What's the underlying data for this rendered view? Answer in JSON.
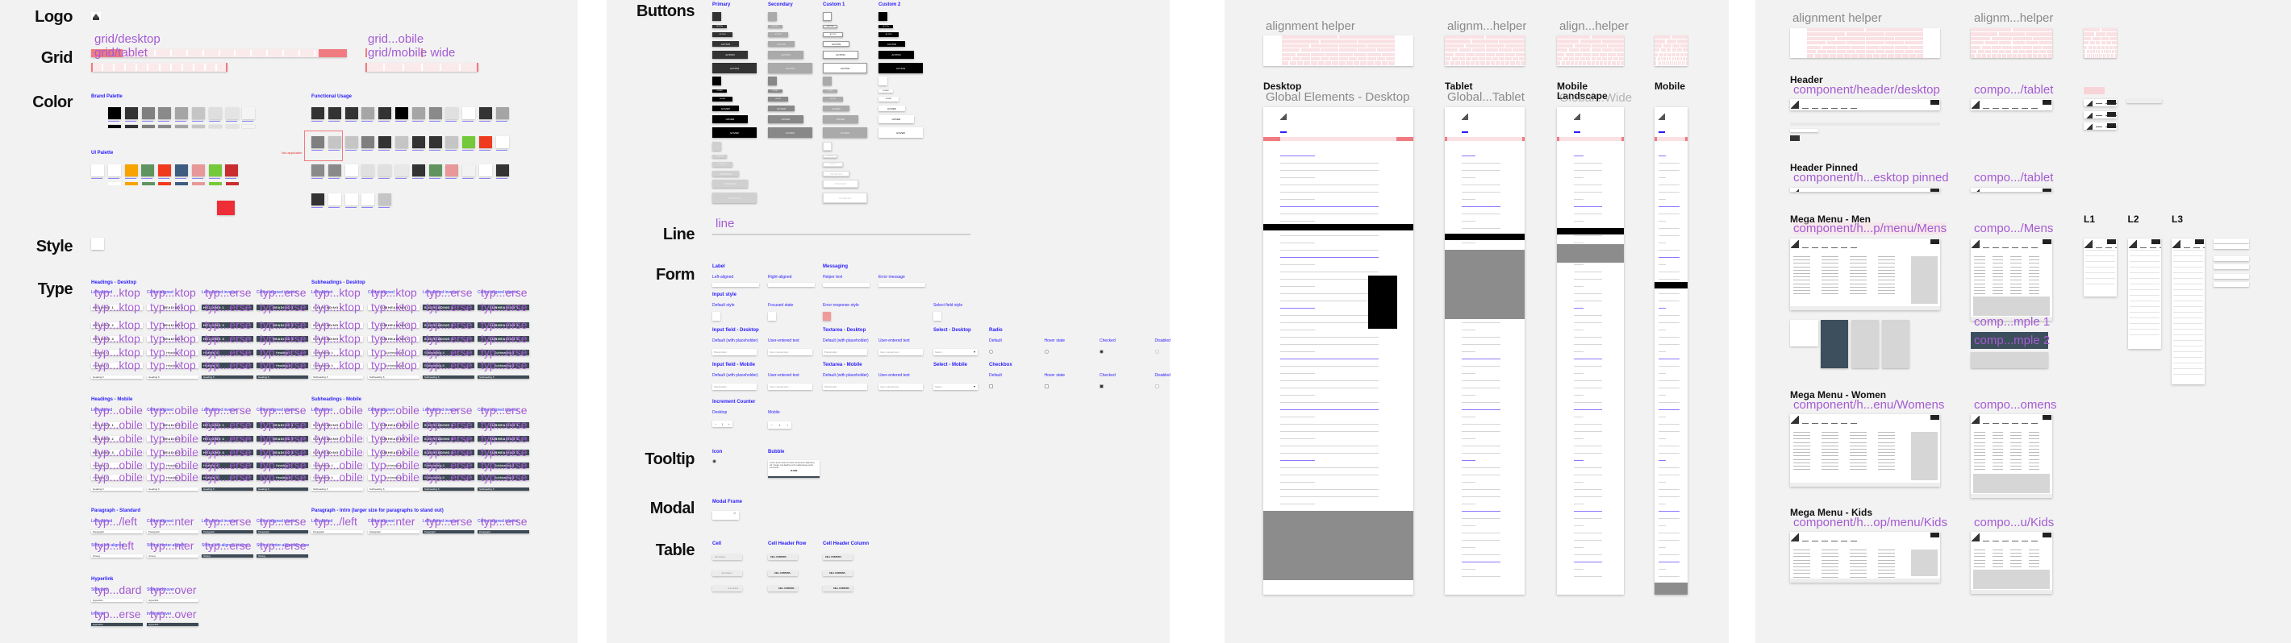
{
  "colors": {
    "panel": "#f2f2f2",
    "label_blue": "#2a1cff",
    "component_purple": "#a45bd3",
    "grid_red": "#f07b80",
    "inverse": "#3d4a55"
  },
  "foundations": {
    "logo": {
      "label": "Logo",
      "icon": "mountain-logo-icon"
    },
    "grid": {
      "label": "Grid",
      "desktop": "grid/desktop",
      "tablet": "grid/tablet",
      "mobile": "grid...obile",
      "mobile_wide": "grid/mobile wide"
    },
    "color": {
      "label": "Color",
      "brand_title": "Brand Palette",
      "ui_title": "UI Palette",
      "functional_title": "Functional Usage",
      "not_applicable": "Not applicable",
      "brand": [
        "#000000",
        "#333333",
        "#7f7f7f",
        "#8a8a8a",
        "#a5a5a5",
        "#c5c5c5",
        "#dedede",
        "#e4e4e4",
        "#f4f4f4"
      ],
      "ui": [
        "#ffffff",
        "#ffffff",
        "#f7a400",
        "#5f9460",
        "#f03a1e",
        "#3d5c80",
        "#e89898",
        "#74c93a",
        "#c92d2d"
      ],
      "ui_extra": "#ee2e36",
      "functional": [
        [
          "#333333",
          "#333333",
          "#333333",
          "#a5a5a5",
          "#333333",
          "#000000",
          "#a5a5a5",
          "#8a8a8a",
          "#e0e0e0",
          "#ffffff",
          "#333333",
          "#a5a5a5"
        ],
        [
          "#7f7f7f",
          "#c5c5c5",
          "#c5c5c5",
          "#7f7f7f",
          "#333333",
          "#c5c5c5",
          "#333333",
          "#333333",
          "#c5c5c5",
          "#74c93a",
          "#f03a1e",
          "#ffffff"
        ],
        [
          "#8a8a8a",
          "#8a8a8a",
          "#ffffff",
          "#e0e0e0",
          "#e0e0e0",
          "#e8e8e8",
          "#333333",
          "#5f9460",
          "#e89898",
          "#f2f2f2",
          "#ffffff",
          "#333333"
        ],
        [
          "#333333",
          "#ffffff",
          "#ffffff",
          "#ffffff",
          "#c5c5c5"
        ]
      ]
    },
    "style": {
      "label": "Style"
    },
    "type": {
      "label": "Type",
      "column_labels": [
        "Left-aligned",
        "Center-aligned",
        "Left-aligned inverse",
        "Center-aligned inverse"
      ],
      "groups": [
        {
          "title": "Headings - Desktop",
          "overlay": [
            "typ...ktop",
            "typ...ktop",
            "typ...erse",
            "typ...erse"
          ],
          "samples": [
            "HEADING 1",
            "HEADING 2",
            "HEADING 3",
            "Heading 4",
            "Heading 5"
          ],
          "small": "Heading 6"
        },
        {
          "title": "Subheadings - Desktop",
          "overlay": [
            "typ...ktop",
            "typ...ktop",
            "typ...erse",
            "typ...erse"
          ],
          "samples": [
            "SUBHEADING 1",
            "SUBHEADING 2",
            "SUBHEADING 3",
            "Subheading 4",
            "Subheading 5"
          ],
          "small": "Subheading 6"
        },
        {
          "title": "Headings - Mobile",
          "overlay": [
            "typ...obile",
            "typ...obile",
            "typ...erse",
            "typ...erse"
          ],
          "samples": [
            "HEADING 1",
            "HEADING 2",
            "HEADING 3",
            "Heading 4",
            "Heading 5"
          ],
          "small": "Heading 6"
        },
        {
          "title": "Subheadings - Mobile",
          "overlay": [
            "typ...obile",
            "typ...obile",
            "typ...erse",
            "typ...erse"
          ],
          "samples": [
            "SUBHEADING 1",
            "SUBHEADING 2",
            "SUBHEADING 3",
            "Subheading 4",
            "Subheading 5"
          ],
          "small": "Subheading 6"
        }
      ],
      "paragraph_standard": {
        "title": "Paragraph - Standard",
        "overlay": [
          "typ.../left",
          "typ...nter",
          "typ...erse",
          "typ...erse"
        ],
        "overlay2": [
          "typ...left",
          "typ...nter",
          "typ...erse",
          "typ...erse"
        ],
        "labels2": [
          "Strong left-aligned",
          "Strong center-aligned",
          "Strong left-aligned inverse",
          "Strong center-aligned inverse"
        ],
        "sample": "Paragraph",
        "sample2": "Strong"
      },
      "paragraph_intro": {
        "title": "Paragraph - Intro (larger size for paragraphs to stand out)",
        "overlay": [
          "typ.../left",
          "typ...nter",
          "typ...erse",
          "typ...erse"
        ],
        "sample": "Paragraph"
      },
      "hyperlink": {
        "title": "Hyperlink",
        "labels": [
          "Standard",
          "Standard hover"
        ],
        "overlay": [
          "typ...dard",
          "typ...over"
        ],
        "labels2": [
          "Inverse",
          "Inverse hover"
        ],
        "overlay2": [
          "typ...erse",
          "typ...over"
        ],
        "sample": "Hyperlink"
      }
    }
  },
  "components": {
    "buttons": {
      "label": "Buttons",
      "columns": [
        "Primary",
        "Secondary",
        "Custom 1",
        "Custom 2"
      ],
      "states": [
        "ACTION",
        "HOVER",
        "DISABLED"
      ]
    },
    "line": {
      "label": "Line",
      "component": "line"
    },
    "form": {
      "label": "Form",
      "label_title": "Label",
      "left_aligned": "Left-aligned",
      "right_aligned": "Right-aligned",
      "messaging_title": "Messaging",
      "helper_text": "Helper text",
      "error_message": "Error message",
      "input_style_title": "Input style",
      "default_style": "Default style",
      "focused_state": "Focused state",
      "error_style": "Error response style",
      "select_style": "Select field style",
      "input_desktop": "Input field - Desktop",
      "textarea_desktop": "Textarea - Desktop",
      "select_desktop": "Select - Desktop",
      "radio": "Radio",
      "input_mobile": "Input field - Mobile",
      "textarea_mobile": "Textarea - Mobile",
      "select_mobile": "Select - Mobile",
      "checkbox": "Checkbox",
      "default_placeholder": "Default (with placeholder)",
      "user_entered": "User-entered text",
      "placeholder": "Placeholder",
      "user_text": "User entered text...",
      "select_placeholder": "Select...",
      "states": [
        "Default",
        "Hover state",
        "Checked",
        "Disabled"
      ],
      "increment_title": "Increment Counter",
      "desktop": "Desktop",
      "mobile": "Mobile",
      "counter_value": "1"
    },
    "tooltip": {
      "label": "Tooltip",
      "icon_title": "Icon",
      "bubble_title": "Bubble",
      "bubble_text": "Lorem ipsum dolor sit amet consectetur adipiscing elit. Integer sed dapibus enim pellentesque porta commodo.",
      "bubble_button": "CLOSE"
    },
    "modal": {
      "label": "Modal",
      "frame_title": "Modal Frame"
    },
    "table": {
      "label": "Table",
      "cell": "Cell",
      "header_row": "Cell Header Row",
      "header_column": "Cell Header Column",
      "cell_text": "cell content...",
      "header_text": "CELL CONTENT..."
    }
  },
  "global_elements": {
    "helpers": [
      "alignment helper",
      "alignm...helper",
      "align...helper"
    ],
    "frames": [
      {
        "title": "Desktop",
        "component": "Global Elements - Desktop"
      },
      {
        "title": "Tablet",
        "component": "Global...Tablet"
      },
      {
        "title": "Mobile Landscape",
        "component": "Global...Wide"
      },
      {
        "title": "Mobile",
        "component": ""
      }
    ]
  },
  "header_library": {
    "helpers": [
      "alignment helper",
      "alignm...helper"
    ],
    "sections": [
      {
        "title": "Header",
        "desktop": "component/header/desktop",
        "tablet": "compo.../tablet"
      },
      {
        "title": "Header Pinned",
        "desktop": "component/h...esktop pinned",
        "tablet": "compo.../tablet"
      },
      {
        "title": "Mega Menu - Men",
        "desktop": "component/h...p/menu/Mens",
        "tablet": "compo.../Mens"
      },
      {
        "title": "Mega Menu - Women",
        "desktop": "component/h...enu/Womens",
        "tablet": "compo...omens"
      },
      {
        "title": "Mega Menu - Kids",
        "desktop": "component/h...op/menu/Kids",
        "tablet": "compo...u/Kids"
      }
    ],
    "examples": [
      "comp...mple 1",
      "comp...mple 2"
    ],
    "levels": [
      "L1",
      "L2",
      "L3"
    ]
  }
}
